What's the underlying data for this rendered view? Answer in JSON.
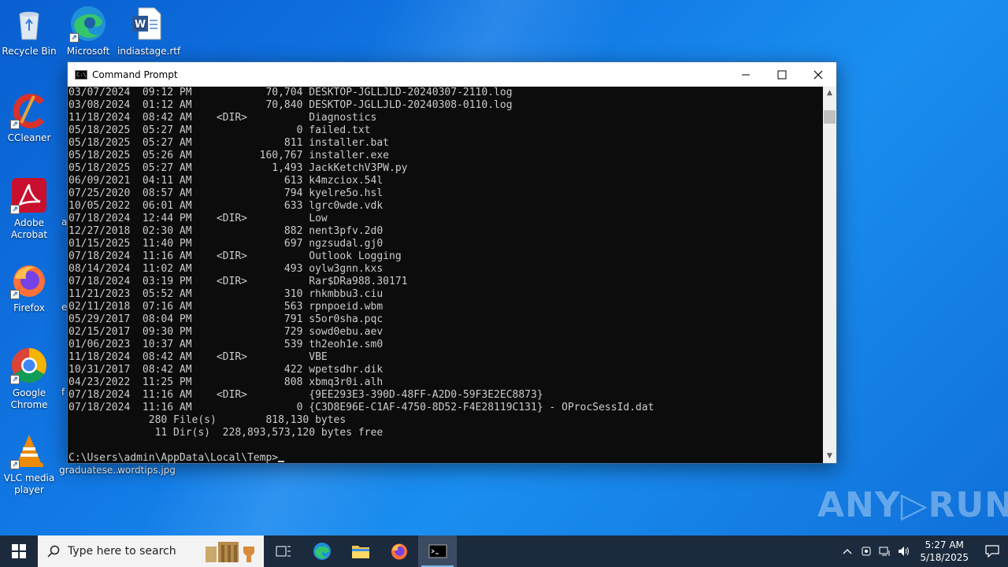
{
  "desktop": {
    "icons": [
      {
        "label": "Recycle Bin"
      },
      {
        "label": "Microsoft Edge"
      },
      {
        "label": "indiastage.rtf"
      },
      {
        "label": "CCleaner"
      },
      {
        "label": "Adobe Acrobat"
      },
      {
        "label": "Firefox"
      },
      {
        "label": "Google Chrome"
      },
      {
        "label": "VLC media player"
      },
      {
        "label": "graduatese..."
      },
      {
        "label": "wordtips.jpg"
      }
    ],
    "partial_labels": [
      "a",
      "e",
      "f"
    ]
  },
  "window": {
    "title": "Command Prompt",
    "lines": [
      "03/07/2024  09:12 PM            70,704 DESKTOP-JGLLJLD-20240307-2110.log",
      "03/08/2024  01:12 AM            70,840 DESKTOP-JGLLJLD-20240308-0110.log",
      "11/18/2024  08:42 AM    <DIR>          Diagnostics",
      "05/18/2025  05:27 AM                 0 failed.txt",
      "05/18/2025  05:27 AM               811 installer.bat",
      "05/18/2025  05:26 AM           160,767 installer.exe",
      "05/18/2025  05:27 AM             1,493 JackKetchV3PW.py",
      "06/09/2021  04:11 AM               613 k4mzciox.54l",
      "07/25/2020  08:57 AM               794 kyelre5o.hsl",
      "10/05/2022  06:01 AM               633 lgrc0wde.vdk",
      "07/18/2024  12:44 PM    <DIR>          Low",
      "12/27/2018  02:30 AM               882 nent3pfv.2d0",
      "01/15/2025  11:40 PM               697 ngzsudal.gj0",
      "07/18/2024  11:16 AM    <DIR>          Outlook Logging",
      "08/14/2024  11:02 AM               493 oylw3gnn.kxs",
      "07/18/2024  03:19 PM    <DIR>          Rar$DRa988.30171",
      "11/21/2023  05:52 AM               310 rhkmbbu3.ciu",
      "02/11/2018  07:16 AM               563 rpnpoeid.wbm",
      "05/29/2017  08:04 PM               791 s5or0sha.pqc",
      "02/15/2017  09:30 PM               729 sowd0ebu.aev",
      "01/06/2023  10:37 AM               539 th2eoh1e.sm0",
      "11/18/2024  08:42 AM    <DIR>          VBE",
      "10/31/2017  08:42 AM               422 wpetsdhr.dik",
      "04/23/2022  11:25 PM               808 xbmq3r0i.alh",
      "07/18/2024  11:16 AM    <DIR>          {9EE293E3-390D-48FF-A2D0-59F3E2EC8873}",
      "07/18/2024  11:16 AM                 0 {C3D8E96E-C1AF-4750-8D52-F4E28119C131} - OProcSessId.dat",
      "             280 File(s)        818,130 bytes",
      "              11 Dir(s)  228,893,573,120 bytes free",
      "",
      "C:\\Users\\admin\\AppData\\Local\\Temp>"
    ]
  },
  "watermark": "ANY▷RUN",
  "taskbar": {
    "search_placeholder": "Type here to search",
    "time": "5:27 AM",
    "date": "5/18/2025"
  },
  "colors": {
    "desktop": "#1178e4",
    "console_bg": "#0c0c0c",
    "console_text": "#cccccc",
    "taskbar": "#1c2a3d"
  }
}
